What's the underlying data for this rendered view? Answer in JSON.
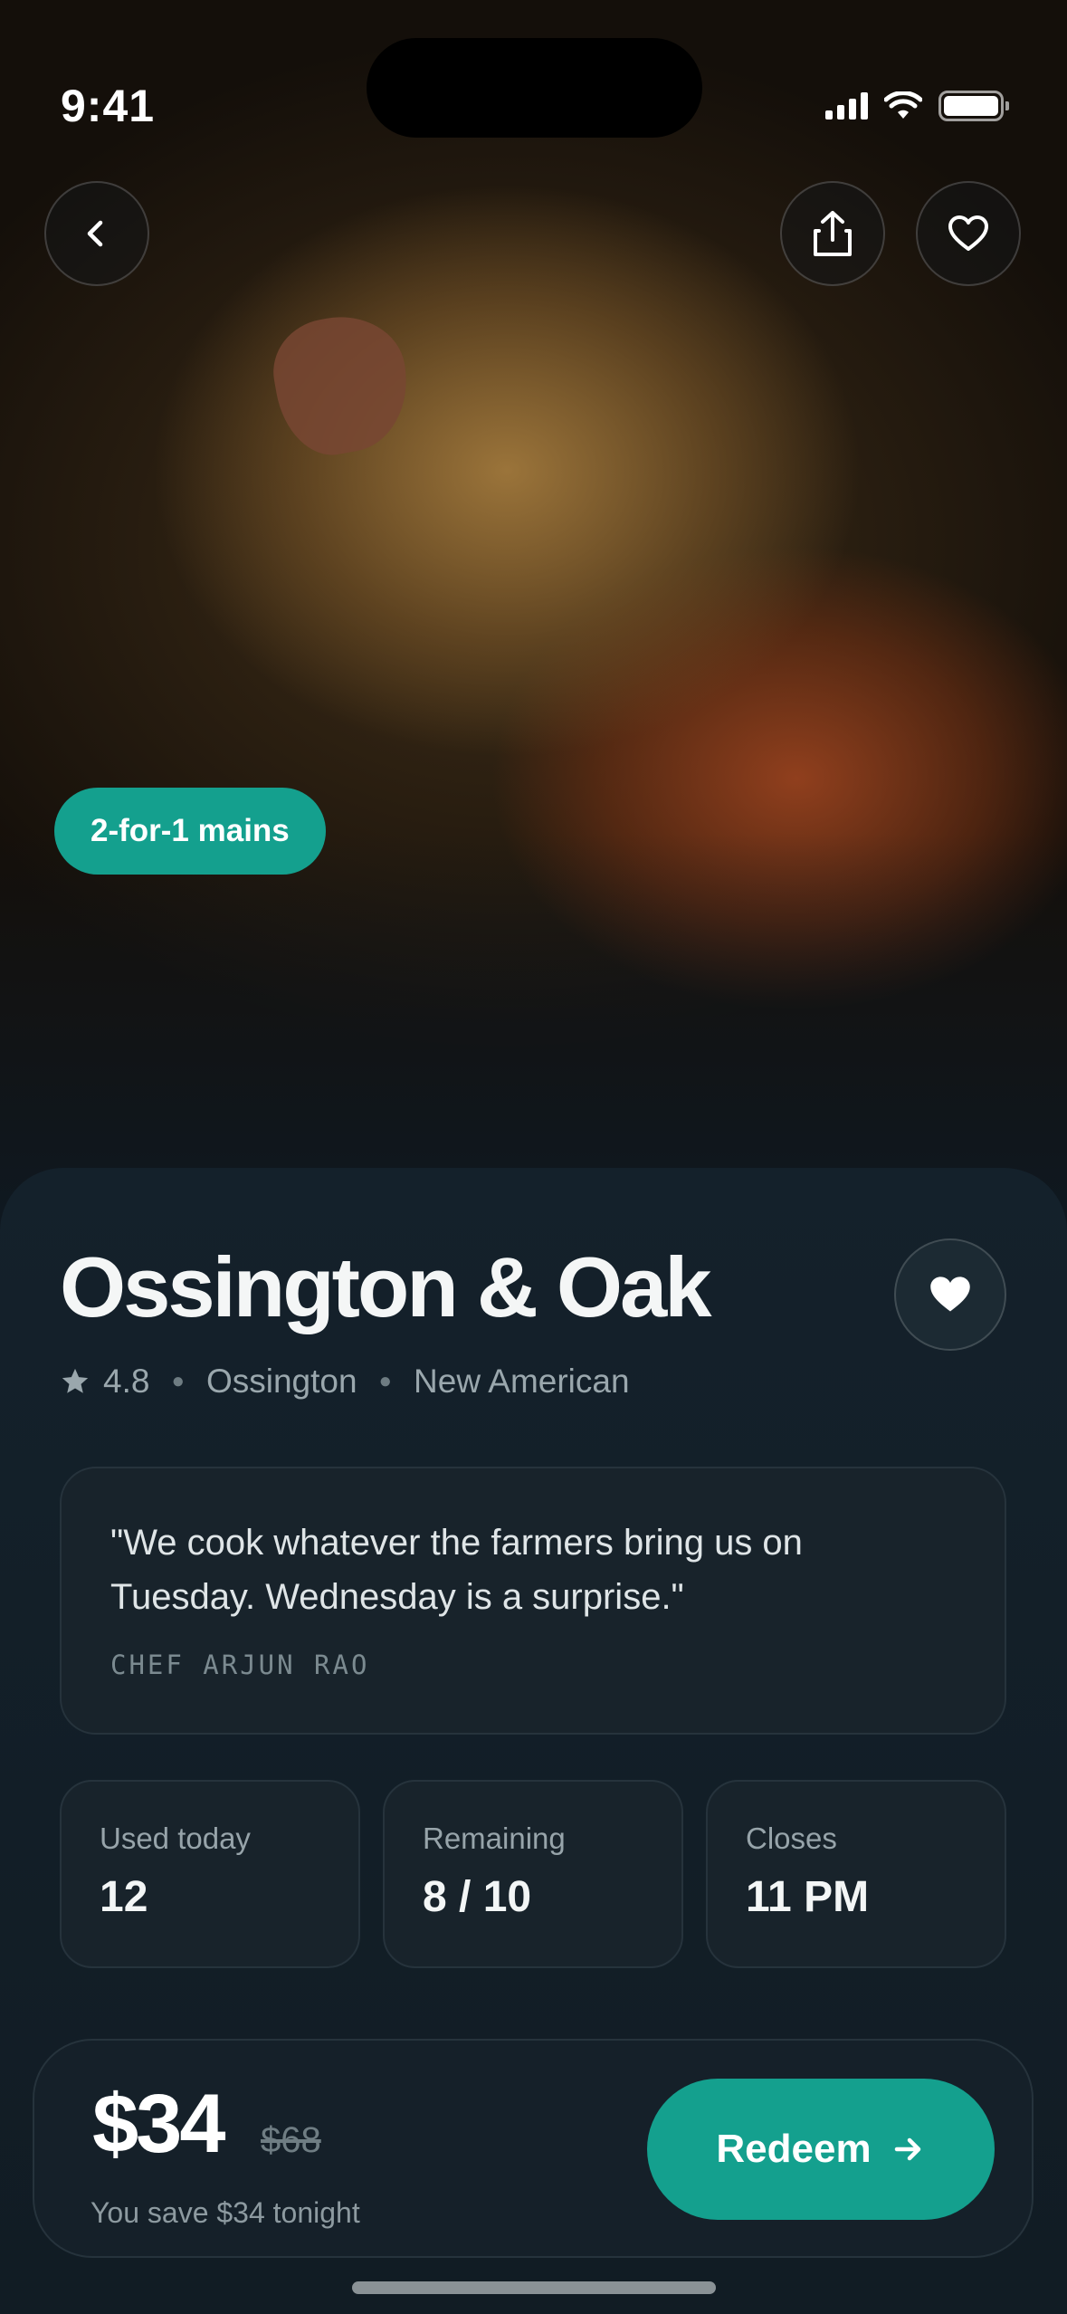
{
  "status_bar": {
    "time": "9:41"
  },
  "hero": {
    "offer_pill": "2-for-1 mains"
  },
  "restaurant": {
    "name": "Ossington & Oak",
    "rating": "4.8",
    "neighborhood": "Ossington",
    "cuisine": "New American"
  },
  "quote": {
    "text": "\"We cook whatever the farmers bring us on Tuesday. Wednesday is a surprise.\"",
    "author": "CHEF ARJUN RAO"
  },
  "stats": [
    {
      "label": "Used today",
      "value": "12"
    },
    {
      "label": "Remaining",
      "value": "8 / 10"
    },
    {
      "label": "Closes",
      "value": "11 PM"
    }
  ],
  "purchase": {
    "price": "$34",
    "original_price": "$68",
    "savings": "You save $34 tonight",
    "redeem_label": "Redeem"
  },
  "colors": {
    "accent": "#14a08e",
    "background": "#0f1820",
    "card": "#18232b"
  },
  "icons": [
    "back-chevron-icon",
    "share-icon",
    "heart-outline-icon",
    "heart-filled-icon",
    "star-icon",
    "arrow-right-icon"
  ]
}
